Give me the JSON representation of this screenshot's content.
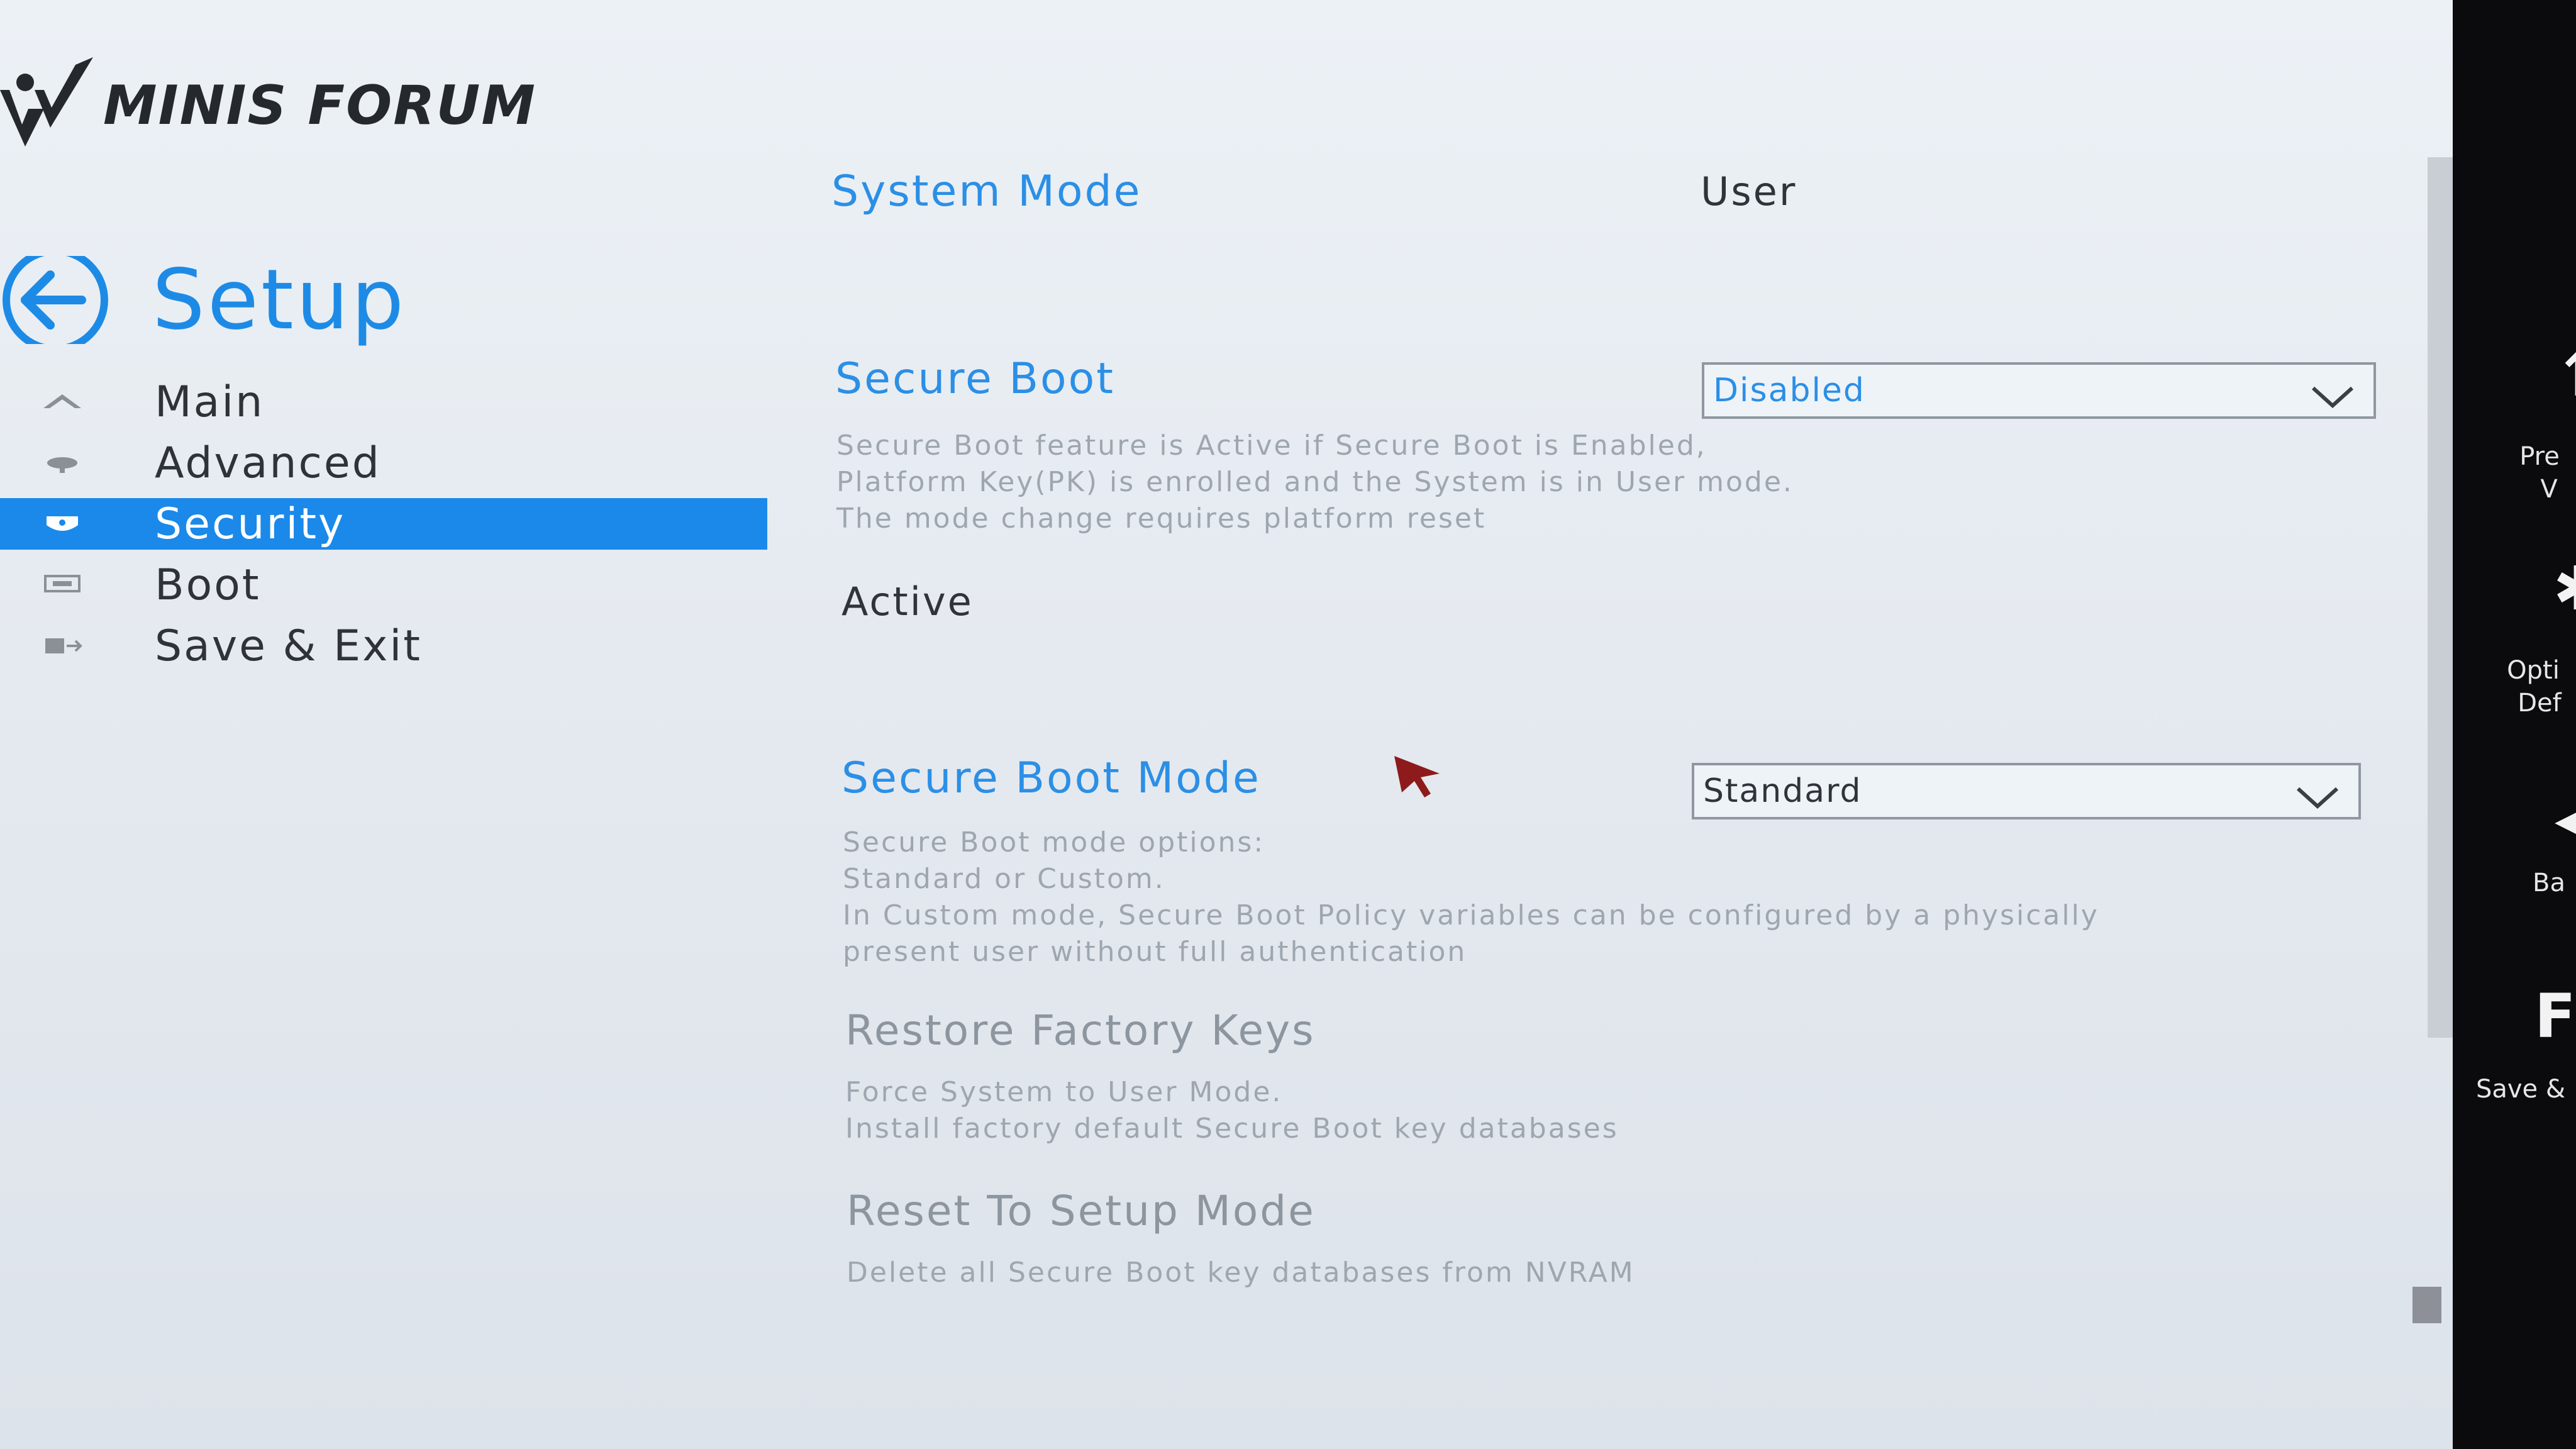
{
  "brand": {
    "logo_text": "MINIS FORUM"
  },
  "header": {
    "title": "Setup",
    "back_icon": "back-arrow-circle-icon"
  },
  "nav": {
    "items": [
      {
        "label": "Main",
        "icon": "home-icon",
        "selected": false
      },
      {
        "label": "Advanced",
        "icon": "advanced-icon",
        "selected": false
      },
      {
        "label": "Security",
        "icon": "shield-icon",
        "selected": true
      },
      {
        "label": "Boot",
        "icon": "boot-icon",
        "selected": false
      },
      {
        "label": "Save & Exit",
        "icon": "save-exit-icon",
        "selected": false
      }
    ]
  },
  "main": {
    "system_mode": {
      "label": "System Mode",
      "value": "User"
    },
    "secure_boot": {
      "label": "Secure Boot",
      "selected": "Disabled",
      "help": [
        "Secure Boot feature is Active if Secure Boot is Enabled,",
        "Platform Key(PK) is enrolled and the System is in User mode.",
        "The mode change requires platform reset"
      ],
      "status": "Active"
    },
    "secure_boot_mode": {
      "label": "Secure Boot Mode",
      "selected": "Standard",
      "help": [
        "Secure Boot mode options:",
        "Standard or Custom.",
        "In Custom mode, Secure Boot Policy variables can be configured by a physically",
        "present user without full authentication"
      ]
    },
    "restore_factory_keys": {
      "label": "Restore Factory Keys",
      "help": [
        "Force System to User Mode.",
        "Install factory default Secure Boot key databases"
      ]
    },
    "reset_to_setup_mode": {
      "label": "Reset To Setup Mode",
      "help": [
        "Delete all Secure Boot key databases from NVRAM"
      ]
    }
  },
  "right_actions": [
    {
      "label_lines": [
        "Pre",
        "V"
      ]
    },
    {
      "label_lines": [
        "Opti",
        "Def"
      ]
    },
    {
      "label_lines": [
        "Ba"
      ]
    },
    {
      "label_lines": [
        "Save &"
      ]
    }
  ],
  "colors": {
    "accent": "#1a89ea",
    "label_blue": "#2b8fe6",
    "help_gray": "#9ea6af",
    "background": "#e6ebf1",
    "right_bar": "#0b0b0d",
    "cursor": "#8e1b1b"
  }
}
